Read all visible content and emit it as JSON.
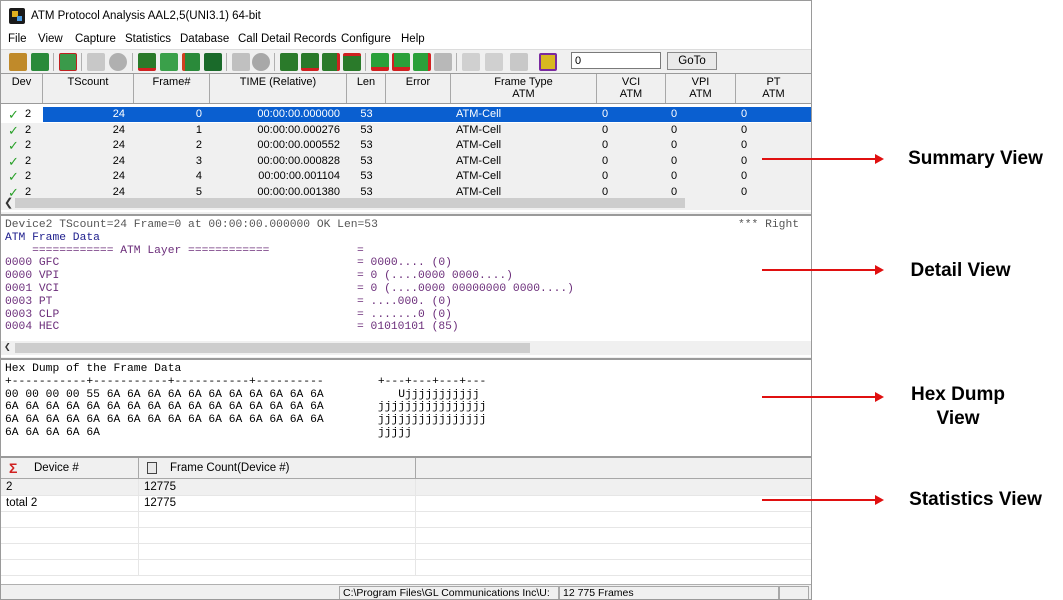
{
  "window": {
    "title": "ATM Protocol Analysis AAL2,5(UNI3.1) 64-bit"
  },
  "menu": [
    "File",
    "View",
    "Capture",
    "Statistics",
    "Database",
    "Call Detail Records",
    "Configure",
    "Help"
  ],
  "toolbar": {
    "goto_value": "0",
    "goto_label": "GoTo"
  },
  "summary": {
    "columns": [
      {
        "label": "Dev",
        "sub": ""
      },
      {
        "label": "TScount",
        "sub": ""
      },
      {
        "label": "Frame#",
        "sub": ""
      },
      {
        "label": "TIME (Relative)",
        "sub": ""
      },
      {
        "label": "Len",
        "sub": ""
      },
      {
        "label": "Error",
        "sub": ""
      },
      {
        "label": "Frame Type",
        "sub": "ATM"
      },
      {
        "label": "VCI",
        "sub": "ATM"
      },
      {
        "label": "VPI",
        "sub": "ATM"
      },
      {
        "label": "PT",
        "sub": "ATM"
      }
    ],
    "rows": [
      {
        "dev": "2",
        "tscount": "24",
        "frame": "0",
        "time": "00:00:00.000000",
        "len": "53",
        "error": "",
        "type": "ATM-Cell",
        "vci": "0",
        "vpi": "0",
        "pt": "0"
      },
      {
        "dev": "2",
        "tscount": "24",
        "frame": "1",
        "time": "00:00:00.000276",
        "len": "53",
        "error": "",
        "type": "ATM-Cell",
        "vci": "0",
        "vpi": "0",
        "pt": "0"
      },
      {
        "dev": "2",
        "tscount": "24",
        "frame": "2",
        "time": "00:00:00.000552",
        "len": "53",
        "error": "",
        "type": "ATM-Cell",
        "vci": "0",
        "vpi": "0",
        "pt": "0"
      },
      {
        "dev": "2",
        "tscount": "24",
        "frame": "3",
        "time": "00:00:00.000828",
        "len": "53",
        "error": "",
        "type": "ATM-Cell",
        "vci": "0",
        "vpi": "0",
        "pt": "0"
      },
      {
        "dev": "2",
        "tscount": "24",
        "frame": "4",
        "time": "00:00:00.001104",
        "len": "53",
        "error": "",
        "type": "ATM-Cell",
        "vci": "0",
        "vpi": "0",
        "pt": "0"
      },
      {
        "dev": "2",
        "tscount": "24",
        "frame": "5",
        "time": "00:00:00.001380",
        "len": "53",
        "error": "",
        "type": "ATM-Cell",
        "vci": "0",
        "vpi": "0",
        "pt": "0"
      }
    ]
  },
  "detail": {
    "header": "Device2 TScount=24 Frame=0 at 00:00:00.000000 OK Len=53",
    "header_right": "*** Right",
    "section": "ATM Frame Data",
    "layer": "    ============ ATM Layer ============",
    "layer_eq": "=",
    "fields": [
      {
        "name": "0000 GFC",
        "value": "= 0000.... (0)"
      },
      {
        "name": "0000 VPI",
        "value": "= 0 (....0000 0000....)"
      },
      {
        "name": "0001 VCI",
        "value": "= 0 (....0000 00000000 0000....)"
      },
      {
        "name": "0003 PT",
        "value": "= ....000. (0)"
      },
      {
        "name": "0003 CLP",
        "value": "= .......0 (0)"
      },
      {
        "name": "0004 HEC",
        "value": "= 01010101 (85)"
      }
    ]
  },
  "hexdump": {
    "title": "Hex Dump of the Frame Data",
    "lines": [
      "+-----------+-----------+-----------+----------        +---+---+---+---",
      "00 00 00 00 55 6A 6A 6A 6A 6A 6A 6A 6A 6A 6A 6A           Ujjjjjjjjjjj",
      "6A 6A 6A 6A 6A 6A 6A 6A 6A 6A 6A 6A 6A 6A 6A 6A        jjjjjjjjjjjjjjjj",
      "6A 6A 6A 6A 6A 6A 6A 6A 6A 6A 6A 6A 6A 6A 6A 6A        jjjjjjjjjjjjjjjj",
      "6A 6A 6A 6A 6A                                         jjjjj"
    ]
  },
  "stats": {
    "columns": [
      "Device #",
      "Frame Count(Device #)"
    ],
    "rows": [
      {
        "device": "2",
        "count": "12775"
      },
      {
        "device": "total 2",
        "count": "12775"
      }
    ]
  },
  "statusbar": {
    "path": "C:\\Program Files\\GL Communications Inc\\U:",
    "frames": "12 775 Frames"
  },
  "callouts": {
    "summary": "Summary View",
    "detail": "Detail View",
    "hex": "Hex Dump View",
    "stats": "Statistics View"
  },
  "colors": {
    "selection": "#0a5fd0",
    "detail_text": "#6b2d7a",
    "arrow": "#e01010",
    "check": "#28a028"
  }
}
